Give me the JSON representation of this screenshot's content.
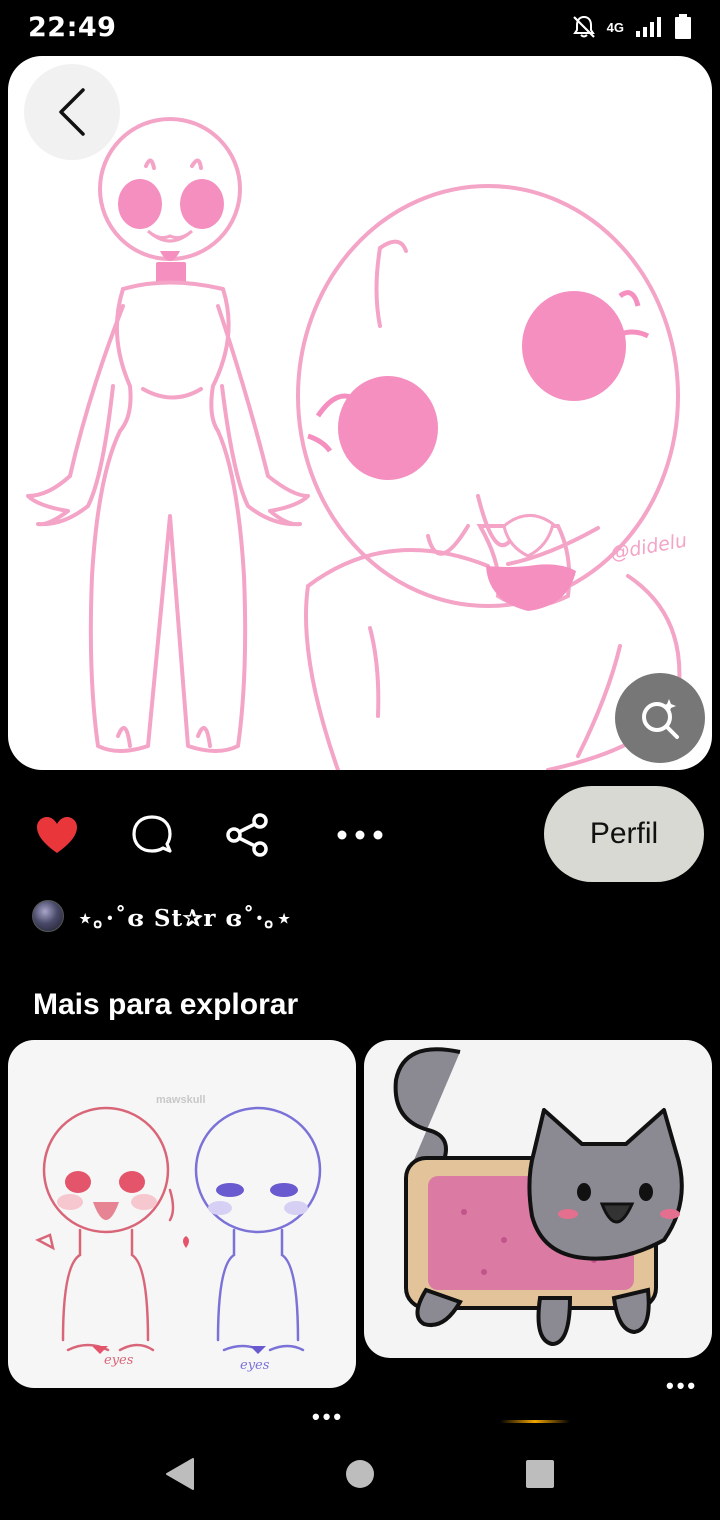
{
  "status_bar": {
    "time": "22:49",
    "network": "4G",
    "icons": [
      "bell-off-icon",
      "signal-icon",
      "battery-icon"
    ]
  },
  "hero": {
    "watermark": "@didelu",
    "icons": [
      "back-icon",
      "visual-search-icon"
    ],
    "colors": {
      "line": "#f4a4c7",
      "fill": "#f48fbf",
      "background": "#ffffff"
    }
  },
  "actions": {
    "icons": [
      "heart-icon",
      "comment-icon",
      "share-icon",
      "more-icon"
    ],
    "heart_color": "#e8363b",
    "profile_button": "Perfil"
  },
  "author": {
    "name": "⋆｡·˚ɞ St✰r ɞ˚·｡⋆"
  },
  "explore": {
    "title": "Mais para explorar",
    "pins": [
      {
        "watermark": "mawskull",
        "label_left": "eyes",
        "label_right": "eyes"
      },
      {
        "subject": "nyan-cat"
      }
    ],
    "more_label": "•••"
  },
  "nav": {
    "icons": [
      "back-triangle-icon",
      "home-circle-icon",
      "recents-square-icon"
    ]
  }
}
